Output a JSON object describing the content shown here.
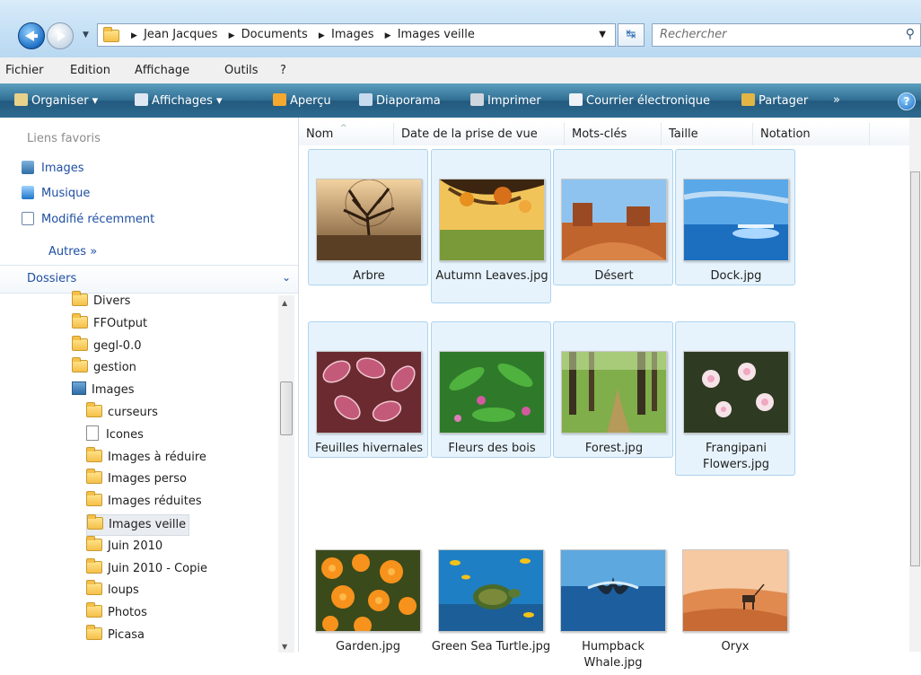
{
  "address": {
    "path": [
      "Jean Jacques",
      "Documents",
      "Images",
      "Images veille"
    ],
    "search_placeholder": "Rechercher"
  },
  "menu": [
    "Fichier",
    "Edition",
    "Affichage",
    "Outils",
    "?"
  ],
  "toolbar": {
    "organiser": "Organiser",
    "affichages": "Affichages",
    "apercu": "Aperçu",
    "diaporama": "Diaporama",
    "imprimer": "Imprimer",
    "courrier": "Courrier électronique",
    "partager": "Partager",
    "more": "»",
    "help": "?"
  },
  "sidebar": {
    "favorites_title": "Liens favoris",
    "favorites": [
      "Images",
      "Musique",
      "Modifié récemment"
    ],
    "autres": "Autres  »",
    "folders_title": "Dossiers",
    "tree": [
      {
        "label": "Divers",
        "type": "folder",
        "level": 0
      },
      {
        "label": "FFOutput",
        "type": "folder",
        "level": 0
      },
      {
        "label": "gegl-0.0",
        "type": "folder",
        "level": 0
      },
      {
        "label": "gestion",
        "type": "folder",
        "level": 0
      },
      {
        "label": "Images",
        "type": "library",
        "level": 0
      },
      {
        "label": "curseurs",
        "type": "folder",
        "level": 1
      },
      {
        "label": "Icones",
        "type": "doc",
        "level": 1
      },
      {
        "label": "Images à réduire",
        "type": "folder",
        "level": 1
      },
      {
        "label": "Images perso",
        "type": "folder",
        "level": 1
      },
      {
        "label": "Images réduites",
        "type": "folder",
        "level": 1
      },
      {
        "label": "Images veille",
        "type": "folder",
        "level": 1,
        "selected": true
      },
      {
        "label": "Juin 2010",
        "type": "folder",
        "level": 1
      },
      {
        "label": "Juin 2010 - Copie",
        "type": "folder",
        "level": 1
      },
      {
        "label": "loups",
        "type": "folder",
        "level": 1
      },
      {
        "label": "Photos",
        "type": "folder",
        "level": 1
      },
      {
        "label": "Picasa",
        "type": "folder",
        "level": 1
      }
    ]
  },
  "columns": [
    "Nom",
    "Date de la prise de vue",
    "Mots-clés",
    "Taille",
    "Notation"
  ],
  "files": [
    {
      "name": "Arbre",
      "scene": "tree",
      "selected": true
    },
    {
      "name": "Autumn Leaves.jpg",
      "scene": "autumn",
      "selected": true
    },
    {
      "name": "Désert",
      "scene": "desert",
      "selected": true
    },
    {
      "name": "Dock.jpg",
      "scene": "dock",
      "selected": true
    },
    {
      "name": "Feuilles hivernales",
      "scene": "leaves",
      "selected": true
    },
    {
      "name": "Fleurs des bois",
      "scene": "flowers",
      "selected": true
    },
    {
      "name": "Forest.jpg",
      "scene": "forest",
      "selected": true
    },
    {
      "name": "Frangipani Flowers.jpg",
      "scene": "frangipani",
      "selected": true
    },
    {
      "name": "Garden.jpg",
      "scene": "garden",
      "selected": false
    },
    {
      "name": "Green Sea Turtle.jpg",
      "scene": "turtle",
      "selected": false
    },
    {
      "name": "Humpback Whale.jpg",
      "scene": "whale",
      "selected": false
    },
    {
      "name": "Oryx",
      "scene": "oryx",
      "selected": false
    }
  ]
}
